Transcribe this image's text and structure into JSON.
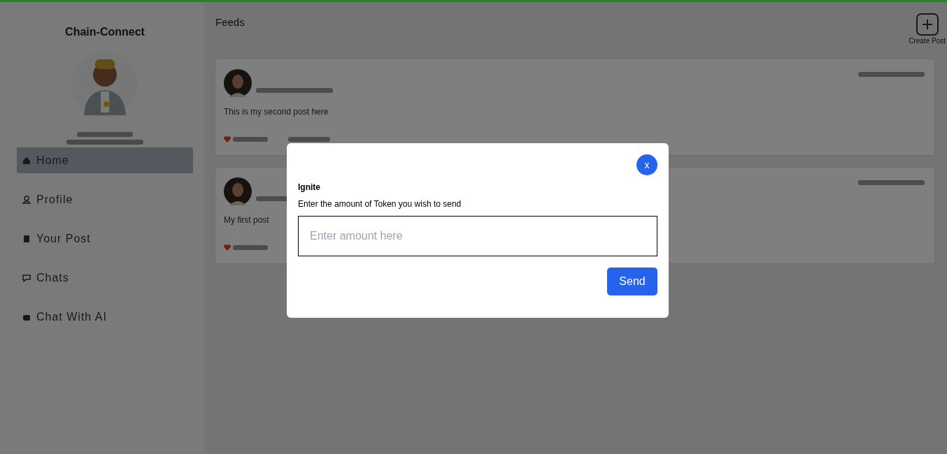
{
  "sidebar": {
    "brand": "Chain-Connect",
    "items": [
      {
        "label": "Home",
        "selected": true
      },
      {
        "label": "Profile",
        "selected": false
      },
      {
        "label": "Your Post",
        "selected": false
      },
      {
        "label": "Chats",
        "selected": false
      },
      {
        "label": "Chat With AI",
        "selected": false
      }
    ]
  },
  "feed": {
    "title": "Feeds",
    "create_button": "Create Post",
    "posts": [
      {
        "text": "This is my second post here"
      },
      {
        "text": "My first post"
      }
    ]
  },
  "dialog": {
    "close": "x",
    "title": "Ignite",
    "prompt": "Enter the amount of Token you wish to send",
    "input": {
      "placeholder": "Enter amount here"
    },
    "submit": "Send"
  }
}
